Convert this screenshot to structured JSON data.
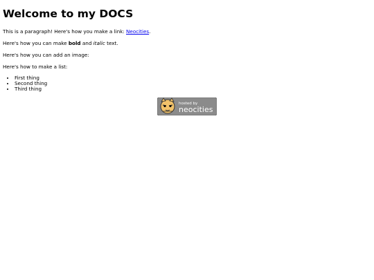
{
  "heading": "Welcome to my DOCS",
  "para1": {
    "text": "This is a paragraph! Here's how you make a link: ",
    "link": "Neocities",
    "end": "."
  },
  "para2": {
    "before": "Here's how you can make ",
    "bold": "bold",
    "middle": " and ",
    "italic": "italic",
    "after": " text."
  },
  "para3": "Here's how you can add an image:",
  "para4": "Here's how to make a list:",
  "list": [
    "First thing",
    "Second thing",
    "Third thing"
  ],
  "badge": {
    "line1": "hosted by",
    "line2": "neocities",
    "bg": "#8b8b8b"
  },
  "colors": {
    "link": "#0000ee"
  }
}
